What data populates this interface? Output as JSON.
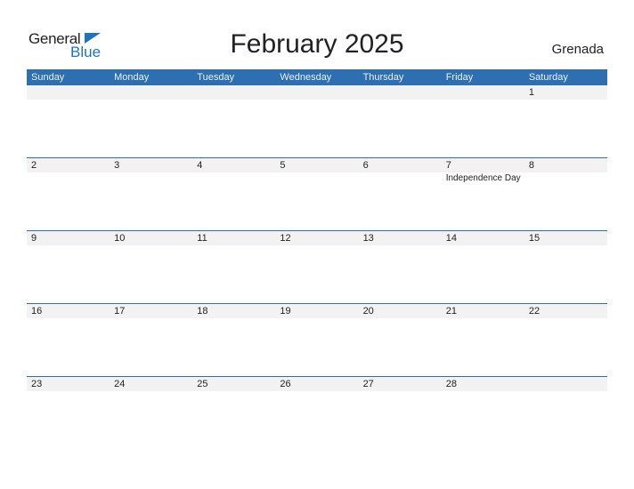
{
  "logo": {
    "line1": "General",
    "line2": "Blue"
  },
  "title": "February 2025",
  "country": "Grenada",
  "weekdays": [
    "Sunday",
    "Monday",
    "Tuesday",
    "Wednesday",
    "Thursday",
    "Friday",
    "Saturday"
  ],
  "weeks": [
    {
      "days": [
        "",
        "",
        "",
        "",
        "",
        "",
        "1"
      ],
      "events": [
        "",
        "",
        "",
        "",
        "",
        "",
        ""
      ]
    },
    {
      "days": [
        "2",
        "3",
        "4",
        "5",
        "6",
        "7",
        "8"
      ],
      "events": [
        "",
        "",
        "",
        "",
        "",
        "Independence Day",
        ""
      ]
    },
    {
      "days": [
        "9",
        "10",
        "11",
        "12",
        "13",
        "14",
        "15"
      ],
      "events": [
        "",
        "",
        "",
        "",
        "",
        "",
        ""
      ]
    },
    {
      "days": [
        "16",
        "17",
        "18",
        "19",
        "20",
        "21",
        "22"
      ],
      "events": [
        "",
        "",
        "",
        "",
        "",
        "",
        ""
      ]
    },
    {
      "days": [
        "23",
        "24",
        "25",
        "26",
        "27",
        "28",
        ""
      ],
      "events": [
        "",
        "",
        "",
        "",
        "",
        "",
        ""
      ]
    }
  ],
  "colors": {
    "header_bg": "#2e6fb2",
    "row_bg": "#f2f2f2",
    "brand_blue": "#1e73be"
  }
}
